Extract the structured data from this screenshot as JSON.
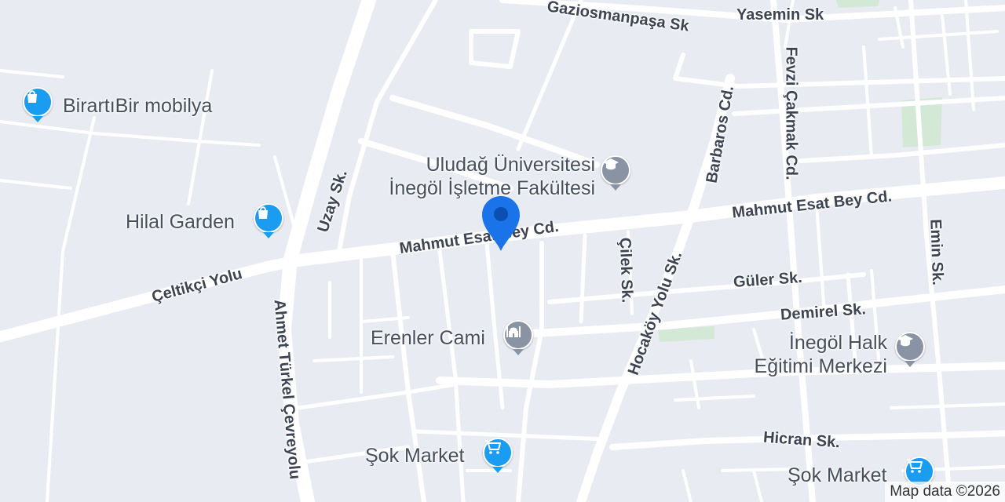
{
  "map": {
    "colors": {
      "background": "#e8ebf1",
      "road": "#ffffff",
      "park": "#d3e9d5",
      "shop_pin": "#1a9cf0",
      "school_pin": "#8a93a3",
      "landmark_pin": "#8a93a3",
      "location_marker": "#1a73e8"
    },
    "streets": [
      {
        "name": "Gaziosmanpaşa Sk"
      },
      {
        "name": "Yasemin Sk"
      },
      {
        "name": "Fevzi Çakmak Cd."
      },
      {
        "name": "Barbaros Cd."
      },
      {
        "name": "Mahmut Esat Bey Cd."
      },
      {
        "name": "Mahmut Esat Bey Cd."
      },
      {
        "name": "Uzay Sk."
      },
      {
        "name": "Çeltikçi Yolu"
      },
      {
        "name": "Ahmet Türkel Çevreyolu"
      },
      {
        "name": "Çilek Sk."
      },
      {
        "name": "Hocaköy Yolu Sk."
      },
      {
        "name": "Güler Sk."
      },
      {
        "name": "Demirel Sk."
      },
      {
        "name": "Emin Sk."
      },
      {
        "name": "Hicran Sk."
      }
    ],
    "pois": [
      {
        "name": "BirartıBir mobilya",
        "icon": "shopping-bag-icon"
      },
      {
        "name": "Hilal Garden",
        "icon": "shopping-bag-icon"
      },
      {
        "name_line1": "Uludağ Üniversitesi",
        "name_line2": "İnegöl İşletme Fakültesi",
        "icon": "graduation-cap-icon"
      },
      {
        "name": "Erenler Cami",
        "icon": "mosque-icon"
      },
      {
        "name_line1": "İnegöl Halk",
        "name_line2": "Eğitimi Merkezi",
        "icon": "graduation-cap-icon"
      },
      {
        "name": "Şok Market",
        "icon": "shopping-cart-icon"
      },
      {
        "name": "Şok Market",
        "icon": "shopping-cart-icon"
      }
    ],
    "marker": {
      "icon": "location-pin-icon"
    },
    "attribution": "Map data ©2026"
  }
}
